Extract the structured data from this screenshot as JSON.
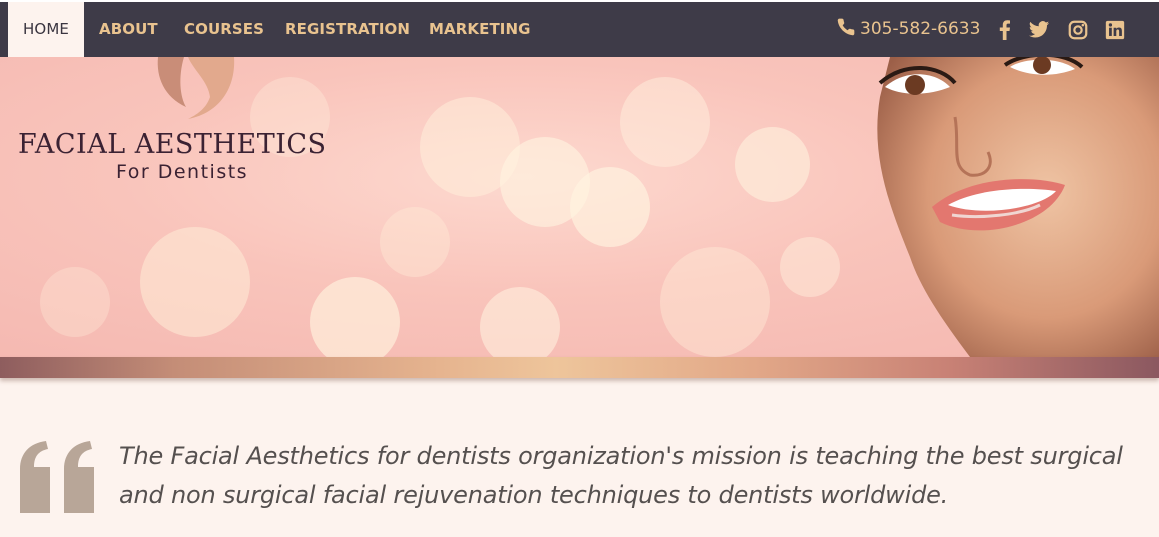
{
  "nav": {
    "items": [
      {
        "label": "HOME",
        "active": true
      },
      {
        "label": "ABOUT",
        "active": false
      },
      {
        "label": "COURSES",
        "active": false
      },
      {
        "label": "REGISTRATION",
        "active": false
      },
      {
        "label": "MARKETING",
        "active": false
      }
    ],
    "phone": "305-582-6633",
    "phone_icon": "phone-icon",
    "social": [
      "facebook-icon",
      "twitter-icon",
      "instagram-icon",
      "linkedin-icon"
    ]
  },
  "brand": {
    "title": "FACIAL AESTHETICS",
    "subtitle": "For Dentists"
  },
  "mission": {
    "text": "The Facial Aesthetics for dentists organization's mission is teaching the best surgical and non surgical facial rejuvenation techniques to dentists worldwide.",
    "quote_icon": "quote-icon"
  },
  "colors": {
    "nav_bg": "#3e3b48",
    "nav_text": "#e9c38f",
    "page_bg": "#fdf3ee",
    "quote_mark": "#b8a698",
    "mission_text": "#55504f"
  }
}
